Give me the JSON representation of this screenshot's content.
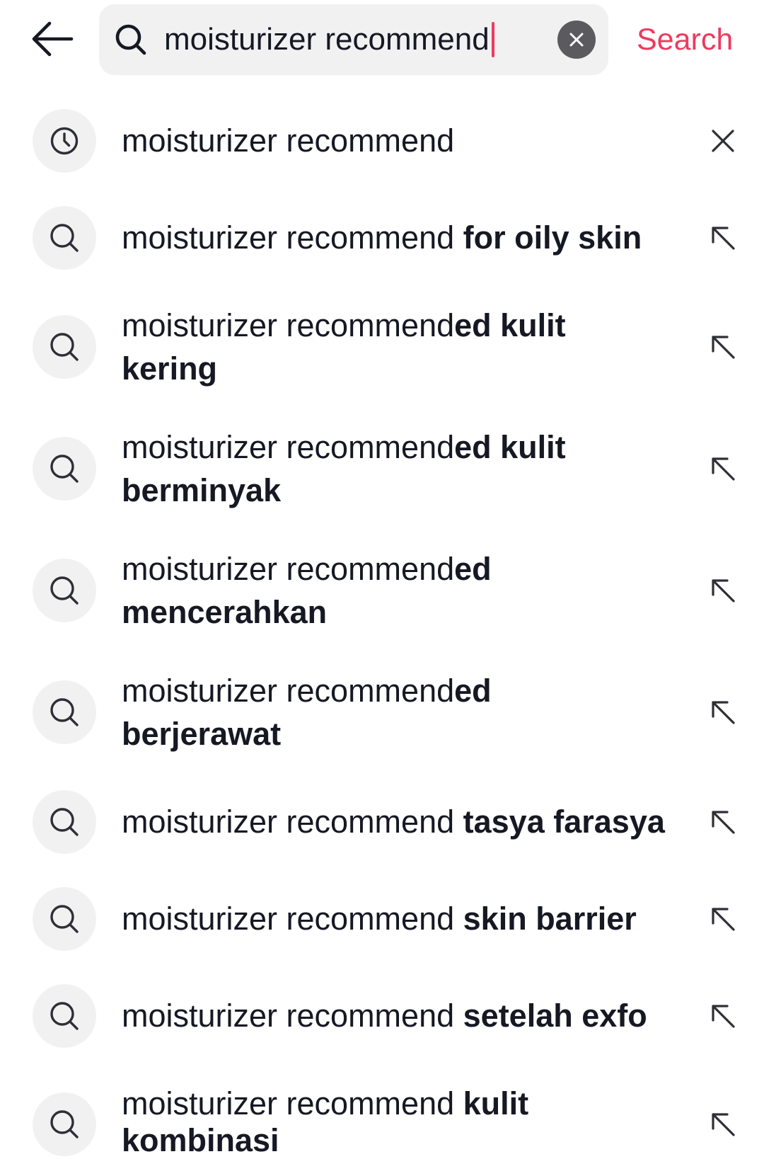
{
  "header": {
    "back_icon": "arrow-left-icon",
    "search_icon": "search-icon",
    "query": "moisturizer recommend",
    "clear_icon": "clear-circle-icon",
    "search_label": "Search"
  },
  "theme": {
    "accent": "#EE3A5F",
    "text": "#161823",
    "field_background": "#F1F1F2",
    "icon_badge_background": "#F1F1F2",
    "clear_button_background": "#5A5A5F",
    "icon": "#2E2F36"
  },
  "suggestions": [
    {
      "icon": "clock-icon",
      "text": "moisturizer recommend",
      "action_icon": "close-icon"
    },
    {
      "icon": "search-icon",
      "text": "moisturizer recommend",
      "completion": " for oily skin",
      "action_icon": "arrow-up-left-icon"
    },
    {
      "icon": "search-icon",
      "text": "moisturizer recommend",
      "completion": "ed kulit",
      "completion_line2": "kering",
      "action_icon": "arrow-up-left-icon"
    },
    {
      "icon": "search-icon",
      "text": "moisturizer recommend",
      "completion": "ed kulit",
      "completion_line2": "berminyak",
      "action_icon": "arrow-up-left-icon"
    },
    {
      "icon": "search-icon",
      "text": "moisturizer recommend",
      "completion": "ed",
      "completion_line2": "mencerahkan",
      "action_icon": "arrow-up-left-icon"
    },
    {
      "icon": "search-icon",
      "text": "moisturizer recommend",
      "completion": "ed",
      "completion_line2": "berjerawat",
      "action_icon": "arrow-up-left-icon"
    },
    {
      "icon": "search-icon",
      "text": "moisturizer recommend",
      "completion": " tasya farasya",
      "action_icon": "arrow-up-left-icon"
    },
    {
      "icon": "search-icon",
      "text": "moisturizer recommend",
      "completion": " skin barrier",
      "action_icon": "arrow-up-left-icon"
    },
    {
      "icon": "search-icon",
      "text": "moisturizer recommend",
      "completion": " setelah exfo",
      "action_icon": "arrow-up-left-icon"
    },
    {
      "icon": "search-icon",
      "text": "moisturizer recommend",
      "completion": " kulit",
      "completion_line2": "kombinasi",
      "action_icon": "arrow-up-left-icon"
    }
  ]
}
